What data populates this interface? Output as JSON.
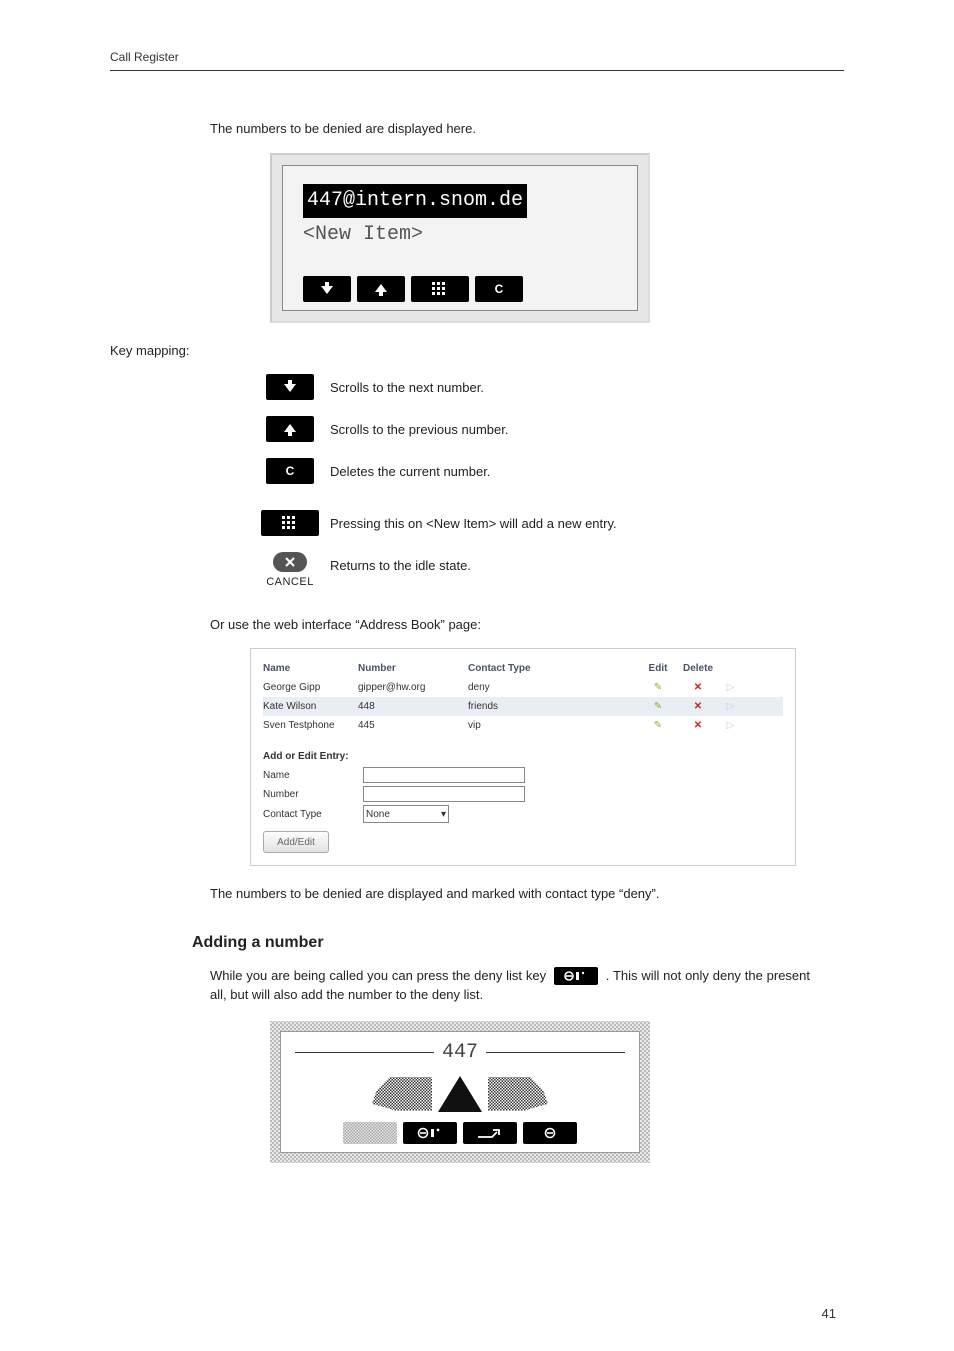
{
  "header": {
    "title": "Call Register"
  },
  "intro": "The numbers to be denied are displayed here.",
  "lcd": {
    "line1": "447@intern.snom.de",
    "line2": "<New Item>"
  },
  "keymap_title": "Key mapping:",
  "keymap": {
    "down": "Scrolls to the next number.",
    "up": "Scrolls to the previous number.",
    "clear": "Deletes the current number.",
    "grid": "Pressing this on <New Item> will add a new entry.",
    "cancel": "Returns to the idle state.",
    "cancel_label": "CANCEL"
  },
  "webintro": "Or use the web interface “Address Book” page:",
  "webtable": {
    "headers": {
      "name": "Name",
      "number": "Number",
      "contact": "Contact Type",
      "edit": "Edit",
      "delete": "Delete"
    },
    "rows": [
      {
        "name": "George Gipp",
        "number": "gipper@hw.org",
        "contact": "deny"
      },
      {
        "name": "Kate Wilson",
        "number": "448",
        "contact": "friends"
      },
      {
        "name": "Sven Testphone",
        "number": "445",
        "contact": "vip"
      }
    ],
    "form": {
      "title": "Add or Edit Entry:",
      "name_label": "Name",
      "number_label": "Number",
      "contact_label": "Contact Type",
      "contact_value": "None",
      "button": "Add/Edit"
    }
  },
  "after_table": "The numbers to be denied are displayed and marked with contact type “deny”.",
  "section": "Adding a number",
  "adding_para_a": "While you are being called you can press the deny list key ",
  "adding_para_b": ". This will not only deny the present all, but will also add the number to the deny list.",
  "call_fig": {
    "number": "447"
  },
  "page_number": "41"
}
